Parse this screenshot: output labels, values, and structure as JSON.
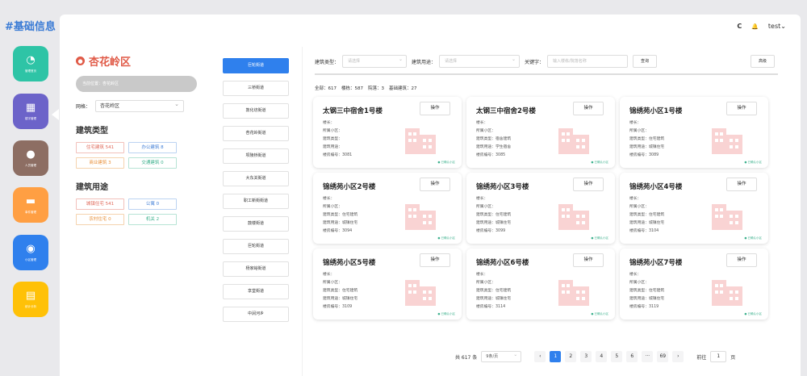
{
  "app": {
    "title": "#基础信息"
  },
  "rail": [
    {
      "label": "管理首页",
      "icon": "dashboard-icon",
      "color": "#2ec4a6"
    },
    {
      "label": "楼宇管理",
      "icon": "building-icon",
      "color": "#6c63c9"
    },
    {
      "label": "人员管理",
      "icon": "person-icon",
      "color": "#8d6e63"
    },
    {
      "label": "事件管理",
      "icon": "briefcase-icon",
      "color": "#ff9f43"
    },
    {
      "label": "小区管理",
      "icon": "globe-icon",
      "color": "#2f80ed"
    },
    {
      "label": "统计分析",
      "icon": "report-icon",
      "color": "#ffc107"
    }
  ],
  "topbar": {
    "refresh": "C",
    "bell": "🔔",
    "user": "test"
  },
  "left": {
    "region": "杏花岭区",
    "location": "当前位置：杏花岭区",
    "grid_label": "网格：",
    "grid_value": "杏花岭区",
    "building_type_title": "建筑类型",
    "building_types": [
      {
        "label": "住宅建筑 541",
        "cls": "t-red"
      },
      {
        "label": "办公建筑 8",
        "cls": "t-blue"
      },
      {
        "label": "商业建筑 3",
        "cls": "t-orange"
      },
      {
        "label": "交通建筑 0",
        "cls": "t-green"
      }
    ],
    "building_use_title": "建筑用途",
    "building_uses": [
      {
        "label": "城镇住宅 541",
        "cls": "t-red"
      },
      {
        "label": "公寓 0",
        "cls": "t-blue"
      },
      {
        "label": "农村住宅 0",
        "cls": "t-orange"
      },
      {
        "label": "机关 2",
        "cls": "t-green"
      }
    ]
  },
  "streets": [
    "巨轮街道",
    "三桥街道",
    "敦化坊街道",
    "杏花岭街道",
    "坝陵桥街道",
    "大东关街道",
    "职工新街街道",
    "鼓楼街道",
    "巨轮街道",
    "杨家峪街道",
    "享堂街道",
    "中涧河乡"
  ],
  "filter": {
    "type_label": "建筑类型：",
    "type_placeholder": "请选择",
    "use_label": "建筑用途：",
    "use_placeholder": "请选择",
    "kw_label": "关键字：",
    "kw_placeholder": "输入楼栋/院落名称",
    "search": "查询",
    "advanced": "高级"
  },
  "stats": [
    "全部：617",
    "楼栋：587",
    "院落：3",
    "基础建筑：27"
  ],
  "card_field_labels": [
    "楼长：",
    "所属小区：",
    "建筑类型：",
    "建筑用途：",
    "楼房编号："
  ],
  "cards": [
    {
      "title": "太钢三中宿舍1号楼",
      "op": "操作",
      "type": "",
      "use": "",
      "code": "3081",
      "status": "● 已确认小区"
    },
    {
      "title": "太钢三中宿舍2号楼",
      "op": "操作",
      "type": "宿舍建筑",
      "use": "学生宿舍",
      "code": "3085",
      "status": "● 已确认小区"
    },
    {
      "title": "锦绣苑小区1号楼",
      "op": "操作",
      "type": "住宅建筑",
      "use": "城镇住宅",
      "code": "3089",
      "status": "● 已确认小区"
    },
    {
      "title": "锦绣苑小区2号楼",
      "op": "操作",
      "type": "住宅建筑",
      "use": "城镇住宅",
      "code": "3094",
      "status": "● 已确认小区"
    },
    {
      "title": "锦绣苑小区3号楼",
      "op": "操作",
      "type": "住宅建筑",
      "use": "城镇住宅",
      "code": "3099",
      "status": "● 已确认小区"
    },
    {
      "title": "锦绣苑小区4号楼",
      "op": "操作",
      "type": "住宅建筑",
      "use": "城镇住宅",
      "code": "3104",
      "status": "● 已确认小区"
    },
    {
      "title": "锦绣苑小区5号楼",
      "op": "操作",
      "type": "住宅建筑",
      "use": "城镇住宅",
      "code": "3109",
      "status": "● 已确认小区"
    },
    {
      "title": "锦绣苑小区6号楼",
      "op": "操作",
      "type": "住宅建筑",
      "use": "城镇住宅",
      "code": "3114",
      "status": "● 已确认小区"
    },
    {
      "title": "锦绣苑小区7号楼",
      "op": "操作",
      "type": "住宅建筑",
      "use": "城镇住宅",
      "code": "3119",
      "status": "● 已确认小区"
    }
  ],
  "pager": {
    "total": "共 617 条",
    "page_size": "9条/页",
    "prev": "‹",
    "pages": [
      "1",
      "2",
      "3",
      "4",
      "5",
      "6",
      "···",
      "69"
    ],
    "next": "›",
    "goto": "前往",
    "goto_value": "1",
    "page_unit": "页"
  },
  "colors": {
    "accent": "#2f80ed",
    "region": "#e05a47",
    "building_icon": "#f7c5c5"
  }
}
